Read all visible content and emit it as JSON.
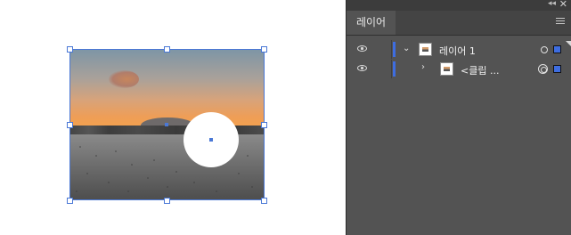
{
  "panel": {
    "collapse_icon": "double-chevron-left-icon",
    "close_icon": "close-icon",
    "tab_label": "레이어",
    "menu_icon": "hamburger-menu-icon",
    "layers": [
      {
        "name": "레이어 1",
        "expanded": true,
        "color": "#3e6de0"
      },
      {
        "name": "<클립 ...",
        "expanded": false,
        "color": "#3e6de0"
      }
    ]
  },
  "canvas": {
    "selection_color": "#4a78d6"
  }
}
